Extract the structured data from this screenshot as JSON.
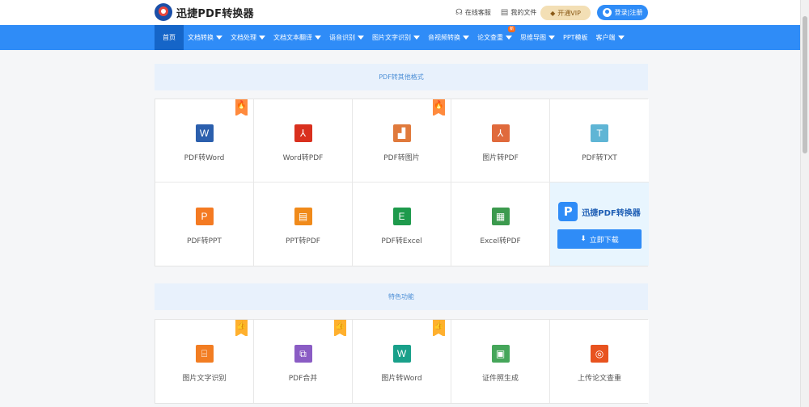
{
  "header": {
    "logo_text": "迅捷PDF转换器",
    "links": [
      {
        "label": "在线客服",
        "icon": "headset-icon"
      },
      {
        "label": "我的文件",
        "icon": "file-icon"
      }
    ],
    "vip_label": "开通VIP",
    "login_label": "登录|注册"
  },
  "nav": {
    "items": [
      {
        "label": "首页",
        "active": true,
        "caret": false
      },
      {
        "label": "文档转换",
        "caret": true
      },
      {
        "label": "文档处理",
        "caret": true
      },
      {
        "label": "文档文本翻译",
        "caret": true
      },
      {
        "label": "语音识别",
        "caret": true
      },
      {
        "label": "图片文字识别",
        "caret": true
      },
      {
        "label": "音视频转换",
        "caret": true
      },
      {
        "label": "论文查重",
        "caret": true,
        "badge": "新"
      },
      {
        "label": "思维导图",
        "caret": true
      },
      {
        "label": "PPT模板",
        "caret": false
      },
      {
        "label": "客户端",
        "caret": true
      }
    ]
  },
  "sections": [
    {
      "title": "PDF转其他格式",
      "tiles": [
        {
          "label": "PDF转Word",
          "glyph": "W",
          "color": "#2b5fad",
          "icon": "word-file-icon",
          "hot": "fire"
        },
        {
          "label": "Word转PDF",
          "glyph": "⅄",
          "color": "#d9301e",
          "icon": "pdf-file-icon"
        },
        {
          "label": "PDF转图片",
          "glyph": "▟",
          "color": "#e07a3c",
          "icon": "image-file-icon",
          "hot": "fire"
        },
        {
          "label": "图片转PDF",
          "glyph": "⅄",
          "color": "#e06a3c",
          "icon": "pdf-file-icon"
        },
        {
          "label": "PDF转TXT",
          "glyph": "T",
          "color": "#5fb5d5",
          "icon": "txt-file-icon"
        },
        {
          "label": "PDF转PPT",
          "glyph": "P",
          "color": "#f47a22",
          "icon": "ppt-file-icon"
        },
        {
          "label": "PPT转PDF",
          "glyph": "▤",
          "color": "#f08a1a",
          "icon": "ppt-pdf-file-icon"
        },
        {
          "label": "PDF转Excel",
          "glyph": "E",
          "color": "#1e9a4c",
          "icon": "excel-file-icon"
        },
        {
          "label": "Excel转PDF",
          "glyph": "▦",
          "color": "#3c9a4e",
          "icon": "excel-pdf-file-icon"
        }
      ],
      "promo": {
        "logo_text": "迅捷PDF转换器",
        "mark": "P",
        "button_label": "立即下载"
      }
    },
    {
      "title": "特色功能",
      "tiles": [
        {
          "label": "图片文字识别",
          "glyph": "⌸",
          "color": "#f27d22",
          "icon": "ocr-icon",
          "hot": "thumb"
        },
        {
          "label": "PDF合并",
          "glyph": "⧉",
          "color": "#8a5cc4",
          "icon": "merge-icon",
          "hot": "thumb"
        },
        {
          "label": "图片转Word",
          "glyph": "W",
          "color": "#19a08a",
          "icon": "word-file-icon",
          "hot": "thumb"
        },
        {
          "label": "证件照生成",
          "glyph": "▣",
          "color": "#45a65a",
          "icon": "id-photo-icon"
        },
        {
          "label": "上传论文查重",
          "glyph": "◎",
          "color": "#e8531f",
          "icon": "scan-icon"
        }
      ]
    }
  ]
}
